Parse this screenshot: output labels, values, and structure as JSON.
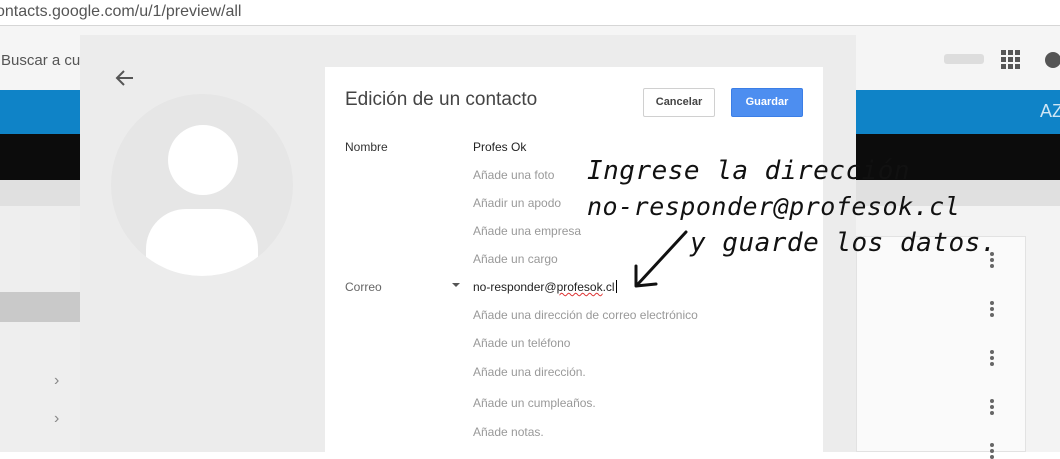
{
  "browser": {
    "url": "ontacts.google.com/u/1/preview/all"
  },
  "background": {
    "search_placeholder": "Buscar a cu",
    "blue_bar_text": "AZ"
  },
  "dialog": {
    "title": "Edición de un contacto",
    "cancel_label": "Cancelar",
    "save_label": "Guardar",
    "name_label": "Nombre",
    "name_value": "Profes Ok",
    "add_photo": "Añade una foto",
    "add_nickname": "Añadir un apodo",
    "add_company": "Añade una empresa",
    "add_job": "Añade un cargo",
    "email_label": "Correo",
    "email_value_prefix": "no-responder@",
    "email_value_misspelled": "profesok",
    "email_value_suffix": ".cl",
    "add_email": "Añade una dirección de correo electrónico",
    "add_phone": "Añade un teléfono",
    "add_address": "Añade una dirección.",
    "add_birthday": "Añade un cumpleaños.",
    "add_notes": "Añade notas."
  },
  "annotation": {
    "line1": "Ingrese la dirección",
    "line2": "no-responder@profesok.cl",
    "line3": "y guarde los datos."
  },
  "icons": {
    "back": "arrow-left-icon",
    "apps": "apps-grid-icon",
    "dropdown": "caret-down-icon",
    "more": "more-vert-icon"
  },
  "colors": {
    "primary_button": "#4d8ef0",
    "header_blue": "#0f83c7",
    "overlay_dialog": "#ececec"
  }
}
